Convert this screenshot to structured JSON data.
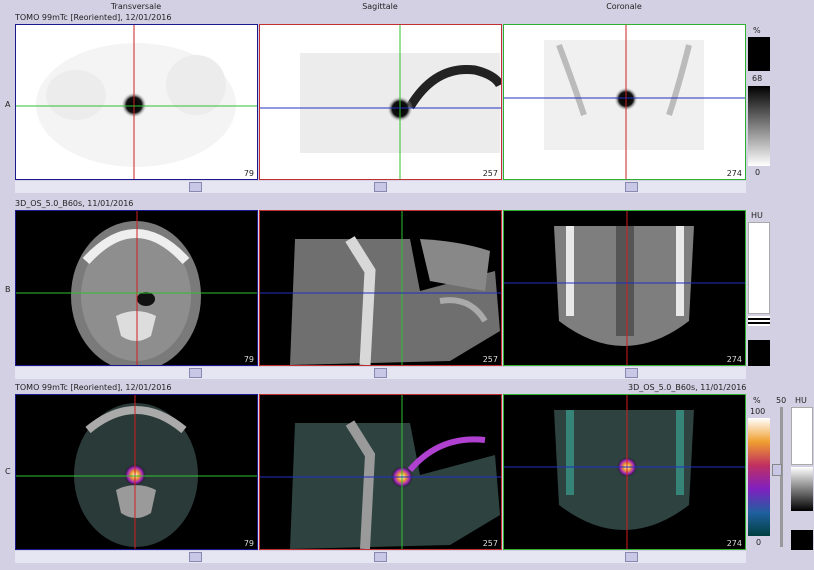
{
  "columns": [
    "Transversale",
    "Sagittale",
    "Coronale"
  ],
  "rows": [
    {
      "label": "A",
      "info": "TOMO 99mTc [Reoriented], 12/01/2016",
      "slices": [
        "79",
        "257",
        "274"
      ]
    },
    {
      "label": "B",
      "info": "3D_OS_5.0_B60s, 11/01/2016",
      "slices": [
        "79",
        "257",
        "274"
      ]
    },
    {
      "label": "C",
      "info": "TOMO 99mTc [Reoriented], 12/01/2016",
      "info_right": "3D_OS_5.0_B60s, 11/01/2016",
      "slices": [
        "79",
        "257",
        "274"
      ]
    }
  ],
  "scales": {
    "pet_a": {
      "unit": "%",
      "top": "68",
      "bottom": "0"
    },
    "ct_b": {
      "unit": "HU"
    },
    "fusion_c": {
      "pet_unit": "%",
      "pet_top": "100",
      "pet_bottom": "0",
      "ct_unit": "HU",
      "mid_label": "50"
    }
  },
  "colors": {
    "transversal_frame": "#1a1a8c",
    "sagittal_frame": "#c03030",
    "coronal_frame": "#30b030",
    "crosshair_vertical": "#d02020",
    "crosshair_horizontal": "#30c030",
    "crosshair_blue": "#2030c0"
  }
}
